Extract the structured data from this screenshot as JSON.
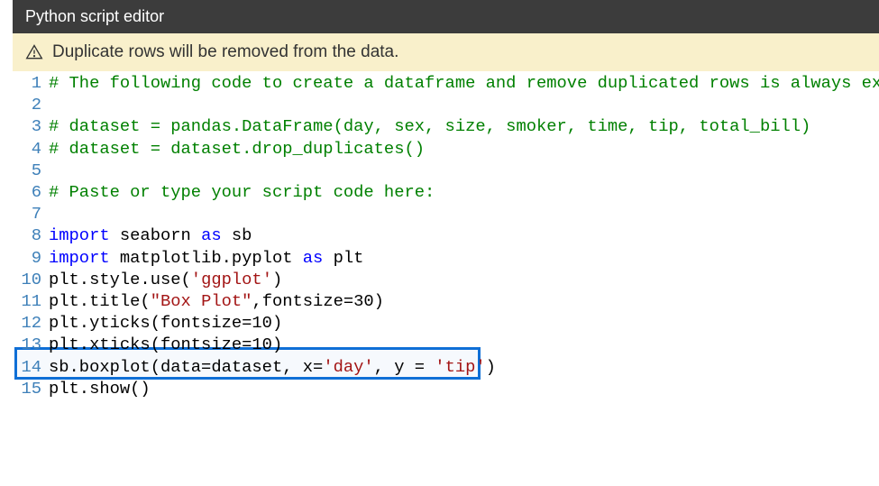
{
  "header": {
    "title": "Python script editor"
  },
  "warning": {
    "text": "Duplicate rows will be removed from the data."
  },
  "highlight_line": 14,
  "colors": {
    "comment": "#008000",
    "keyword": "#0000ff",
    "string": "#a31515",
    "header_bg": "#3c3c3c",
    "warning_bg": "#f9f0cb",
    "highlight_border": "#0f6fd6"
  },
  "lines": [
    {
      "n": 1,
      "tokens": [
        {
          "c": "comment",
          "t": "# The following code to create a dataframe and remove duplicated rows is always executed "
        }
      ]
    },
    {
      "n": 2,
      "tokens": []
    },
    {
      "n": 3,
      "tokens": [
        {
          "c": "comment",
          "t": "# dataset = pandas.DataFrame(day, sex, size, smoker, time, tip, total_bill)"
        }
      ]
    },
    {
      "n": 4,
      "tokens": [
        {
          "c": "comment",
          "t": "# dataset = dataset.drop_duplicates()"
        }
      ]
    },
    {
      "n": 5,
      "tokens": []
    },
    {
      "n": 6,
      "tokens": [
        {
          "c": "comment",
          "t": "# Paste or type your script code here:"
        }
      ]
    },
    {
      "n": 7,
      "tokens": []
    },
    {
      "n": 8,
      "tokens": [
        {
          "c": "keyword",
          "t": "import"
        },
        {
          "c": "ident",
          "t": " seaborn "
        },
        {
          "c": "keyword",
          "t": "as"
        },
        {
          "c": "ident",
          "t": " sb"
        }
      ]
    },
    {
      "n": 9,
      "tokens": [
        {
          "c": "keyword",
          "t": "import"
        },
        {
          "c": "ident",
          "t": " matplotlib.pyplot "
        },
        {
          "c": "keyword",
          "t": "as"
        },
        {
          "c": "ident",
          "t": " plt"
        }
      ]
    },
    {
      "n": 10,
      "tokens": [
        {
          "c": "ident",
          "t": "plt.style.use("
        },
        {
          "c": "string",
          "t": "'ggplot'"
        },
        {
          "c": "ident",
          "t": ")"
        }
      ]
    },
    {
      "n": 11,
      "tokens": [
        {
          "c": "ident",
          "t": "plt.title("
        },
        {
          "c": "string",
          "t": "\"Box Plot\""
        },
        {
          "c": "ident",
          "t": ",fontsize=30)"
        }
      ]
    },
    {
      "n": 12,
      "tokens": [
        {
          "c": "ident",
          "t": "plt.yticks(fontsize=10)"
        }
      ]
    },
    {
      "n": 13,
      "tokens": [
        {
          "c": "ident",
          "t": "plt.xticks(fontsize=10)"
        }
      ]
    },
    {
      "n": 14,
      "tokens": [
        {
          "c": "ident",
          "t": "sb.boxplot(data=dataset, x="
        },
        {
          "c": "string",
          "t": "'day'"
        },
        {
          "c": "ident",
          "t": ", y = "
        },
        {
          "c": "string",
          "t": "'tip'"
        },
        {
          "c": "ident",
          "t": ")"
        }
      ]
    },
    {
      "n": 15,
      "tokens": [
        {
          "c": "ident",
          "t": "plt.show()"
        }
      ]
    }
  ]
}
